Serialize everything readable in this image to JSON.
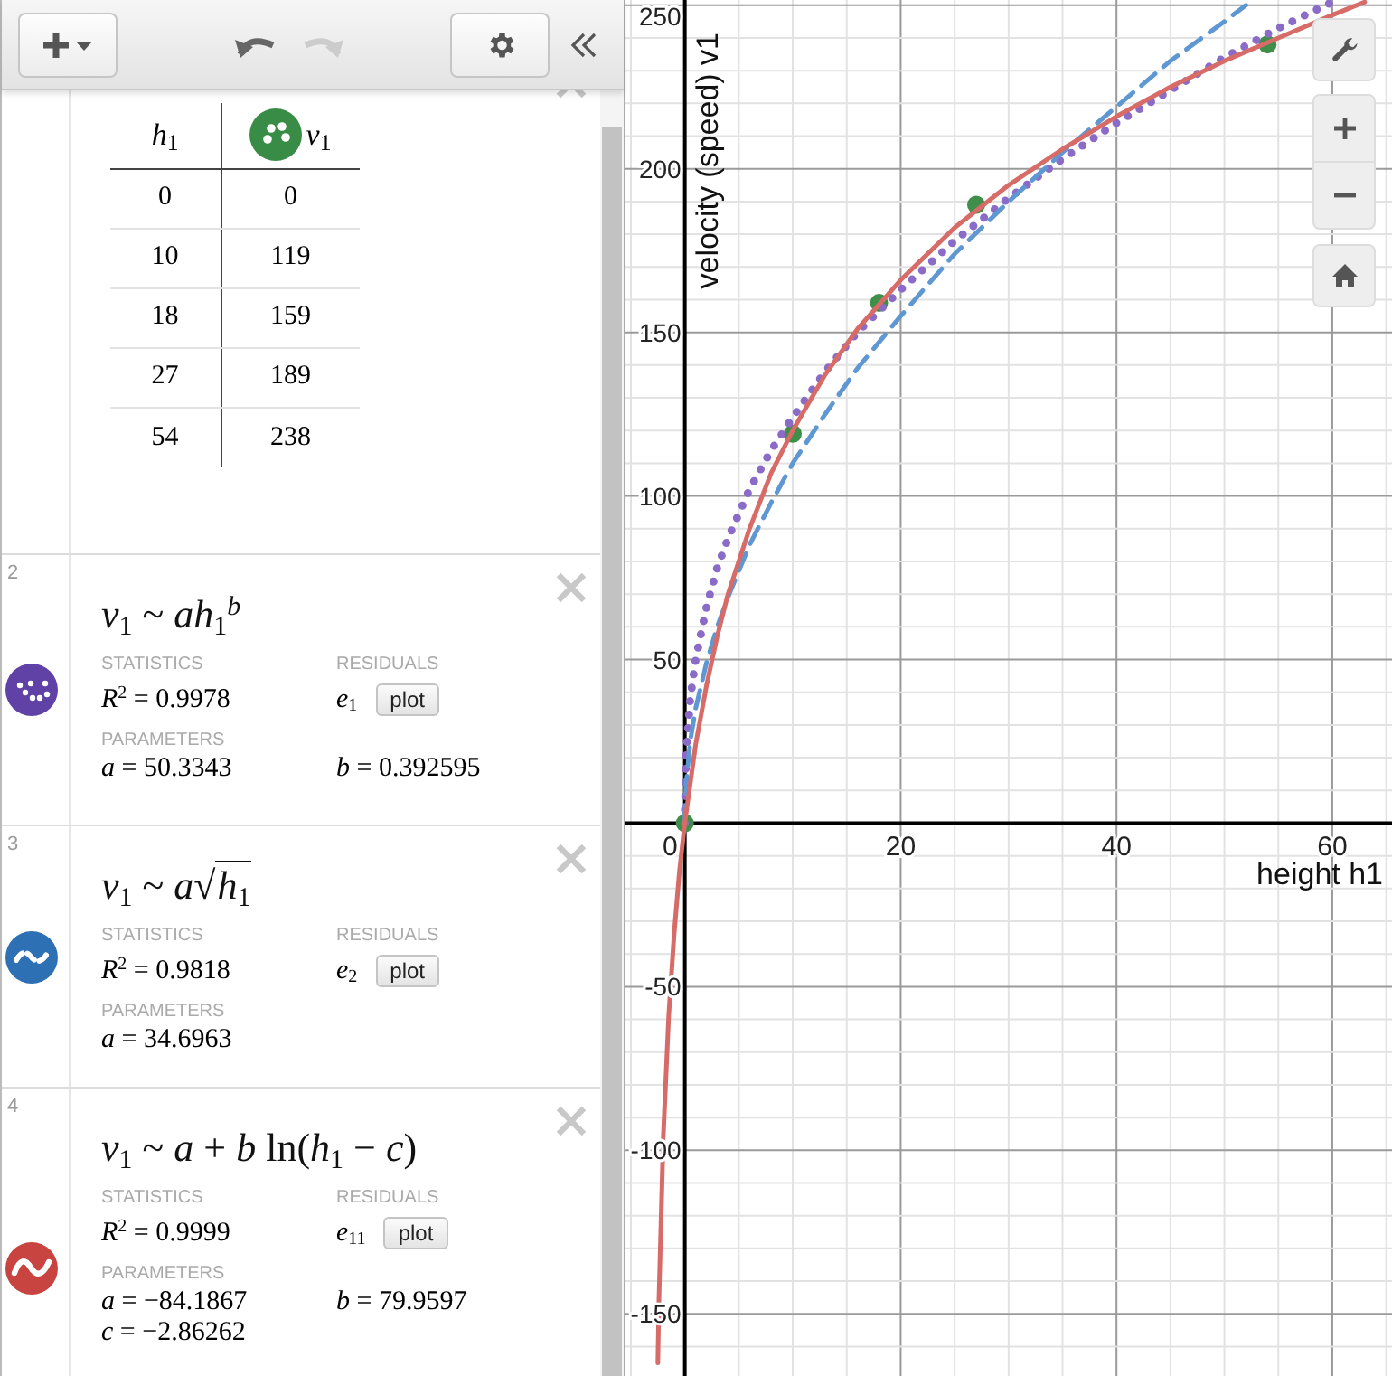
{
  "expressions": [
    {
      "kind": "table",
      "columns": [
        {
          "header": "*h*$_{1}$"
        },
        {
          "header": "*v*$_{1}$",
          "color": "#388c46"
        }
      ],
      "rows": [
        [
          "0",
          "0"
        ],
        [
          "10",
          "119"
        ],
        [
          "18",
          "159"
        ],
        [
          "27",
          "189"
        ],
        [
          "54",
          "238"
        ]
      ]
    },
    {
      "kind": "dotted",
      "number": "2",
      "color": "#6042a6",
      "formula": "*v*$_{1}$ ~ *ah*$_{1}$$^{b}$",
      "statistics_label": "STATISTICS",
      "r_squared": "*R*$^{2}$ = 0.9978",
      "residuals_label": "RESIDUALS",
      "residual_var": "*e*$_{1}$",
      "plot_button": "plot",
      "parameters_label": "PARAMETERS",
      "parameters": [
        "*a* = 50.3343",
        "*b* = 0.392595"
      ]
    },
    {
      "kind": "dashed",
      "number": "3",
      "color": "#2d70b3",
      "formula": "*v*$_{1}$ ~ *a*√",
      "radicand": "*h*$_{1}$",
      "statistics_label": "STATISTICS",
      "r_squared": "*R*$^{2}$ = 0.9818",
      "residuals_label": "RESIDUALS",
      "residual_var": "*e*$_{2}$",
      "plot_button": "plot",
      "parameters_label": "PARAMETERS",
      "parameters": [
        "*a* = 34.6963"
      ]
    },
    {
      "kind": "solid",
      "number": "4",
      "color": "#c74440",
      "formula": "*v*$_{1}$ ~ *a* + *b* ln(*h*$_{1}$ − *c*)",
      "statistics_label": "STATISTICS",
      "r_squared": "*R*$^{2}$ = 0.9999",
      "residuals_label": "RESIDUALS",
      "residual_var": "*e*$_{11}$",
      "plot_button": "plot",
      "parameters_label": "PARAMETERS",
      "parameters": [
        "*a* = −84.1867",
        "*b* = 79.9597",
        "*c* = −2.86262"
      ]
    }
  ],
  "graph": {
    "chart_data": {
      "type": "scatter",
      "xlabel": "height h1",
      "ylabel": "velocity (speed) v1",
      "xlim": [
        -5.5,
        65.7
      ],
      "ylim": [
        -169,
        251.6
      ],
      "xticks": [
        0,
        20,
        40,
        60
      ],
      "yticks": [
        -150,
        -100,
        -50,
        50,
        100,
        150,
        200,
        250
      ],
      "grid": true,
      "series": [
        {
          "type": "scatter",
          "color": "#3f8f4a",
          "x": [
            0,
            10,
            18,
            27,
            54
          ],
          "values": [
            0,
            119,
            159,
            189,
            238
          ]
        },
        {
          "type": "line",
          "line_style": "dotted",
          "color": "#8a6cc8",
          "x": [
            0,
            0.1,
            0.5,
            1,
            2,
            3,
            4,
            6,
            8,
            10,
            13,
            16,
            20,
            25,
            30,
            35,
            40,
            45,
            50,
            55,
            60
          ],
          "values": [
            0,
            20,
            38,
            50,
            66,
            78,
            87,
            102,
            114,
            124,
            138,
            150,
            163,
            178,
            191,
            203,
            214,
            224,
            234,
            243,
            251
          ]
        },
        {
          "type": "line",
          "line_style": "dashed",
          "color": "#5f97d2",
          "x": [
            0,
            0.1,
            0.5,
            1,
            2,
            3,
            4,
            6,
            8,
            10,
            13,
            16,
            20,
            25,
            30,
            35,
            40,
            45,
            50,
            52
          ],
          "values": [
            0,
            11,
            25,
            35,
            49,
            60,
            69,
            85,
            98,
            110,
            125,
            139,
            155,
            174,
            190,
            205,
            219,
            233,
            245,
            250
          ]
        },
        {
          "type": "line",
          "line_style": "solid",
          "color": "#d66b67",
          "x": [
            -2.5,
            -2.4,
            -2,
            -1.5,
            -1,
            -0.5,
            0,
            1,
            2,
            3,
            4,
            6,
            8,
            10,
            13,
            16,
            20,
            25,
            30,
            35,
            40,
            45,
            50,
            55,
            60,
            63
          ],
          "values": [
            -165,
            -146,
            -96,
            -59,
            -34,
            -15,
            0,
            24,
            42,
            57,
            70,
            90,
            107,
            120,
            137,
            151,
            166,
            182,
            195,
            206,
            216,
            225,
            233,
            240,
            247,
            251
          ]
        }
      ]
    }
  }
}
